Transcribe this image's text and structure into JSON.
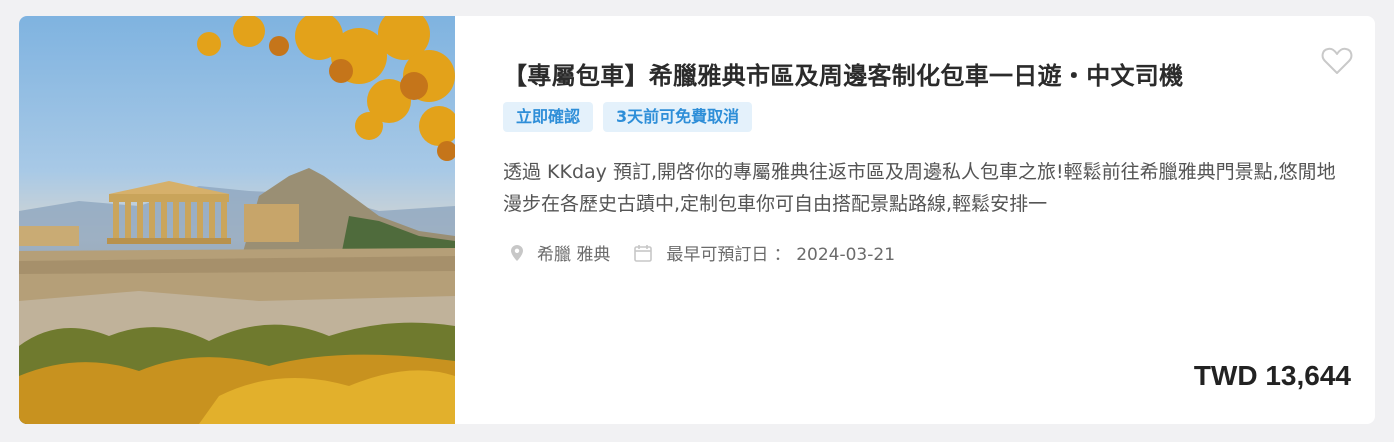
{
  "product": {
    "title": "【專屬包車】希臘雅典市區及周邊客制化包車一日遊・中文司機",
    "tags": [
      "立即確認",
      "3天前可免費取消"
    ],
    "description": "透過 KKday 預訂,開啓你的專屬雅典往返市區及周邊私人包車之旅!輕鬆前往希臘雅典門景點,悠閒地漫步在各歷史古蹟中,定制包車你可自由搭配景點路線,輕鬆安排一",
    "location": "希臘 雅典",
    "earliest_date_label": "最早可預訂日 ： 2024-03-21",
    "price": "TWD 13,644",
    "image_alt": "parthenon-acropolis-photo"
  },
  "icons": {
    "favorite": "heart-outline-icon",
    "location": "map-pin-icon",
    "date": "calendar-icon"
  },
  "colors": {
    "tag_text": "#2e8ed8",
    "tag_bg": "#e4f1fb",
    "title": "#2b2b2b",
    "price": "#222222"
  }
}
